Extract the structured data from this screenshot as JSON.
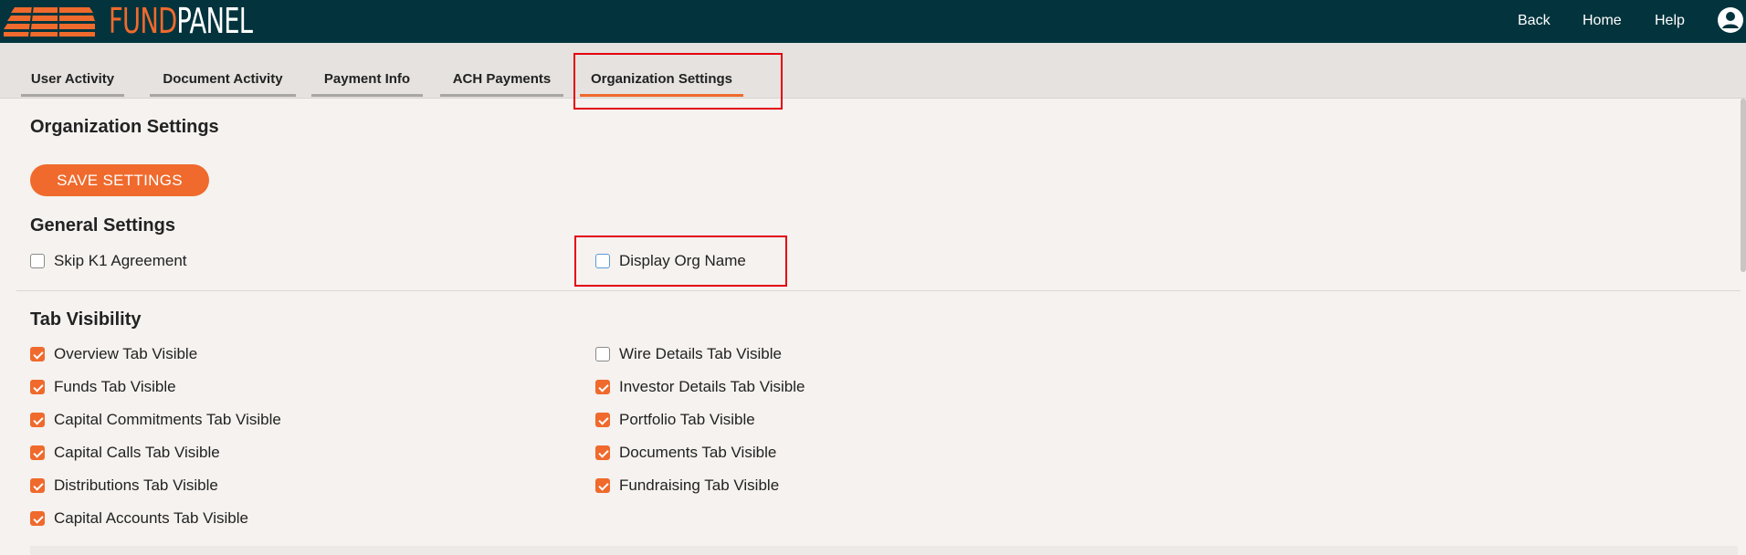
{
  "header": {
    "logo_fund": "FUND",
    "logo_panel": "PANEL",
    "nav": {
      "back": "Back",
      "home": "Home",
      "help": "Help"
    },
    "colors": {
      "bar": "#03343d",
      "accent": "#ef6a2c"
    },
    "icons": [
      "logo-stripes-icon",
      "user-account-icon"
    ]
  },
  "tabs": [
    {
      "label": "User Activity",
      "active": false
    },
    {
      "label": "Document Activity",
      "active": false
    },
    {
      "label": "Payment Info",
      "active": false
    },
    {
      "label": "ACH Payments",
      "active": false
    },
    {
      "label": "Organization Settings",
      "active": true
    }
  ],
  "main": {
    "title": "Organization Settings",
    "save_label": "SAVE SETTINGS",
    "general": {
      "title": "General Settings",
      "items": [
        {
          "label": "Skip K1 Agreement",
          "checked": false
        },
        {
          "label": "Display Org Name",
          "checked": false
        }
      ]
    },
    "tab_visibility": {
      "title": "Tab Visibility",
      "left": [
        {
          "label": "Overview Tab Visible",
          "checked": true
        },
        {
          "label": "Funds Tab Visible",
          "checked": true
        },
        {
          "label": "Capital Commitments Tab Visible",
          "checked": true
        },
        {
          "label": "Capital Calls Tab Visible",
          "checked": true
        },
        {
          "label": "Distributions Tab Visible",
          "checked": true
        },
        {
          "label": "Capital Accounts Tab Visible",
          "checked": true
        }
      ],
      "right": [
        {
          "label": "Wire Details Tab Visible",
          "checked": false
        },
        {
          "label": "Investor Details Tab Visible",
          "checked": true
        },
        {
          "label": "Portfolio Tab Visible",
          "checked": true
        },
        {
          "label": "Documents Tab Visible",
          "checked": true
        },
        {
          "label": "Fundraising Tab Visible",
          "checked": true
        }
      ]
    }
  }
}
